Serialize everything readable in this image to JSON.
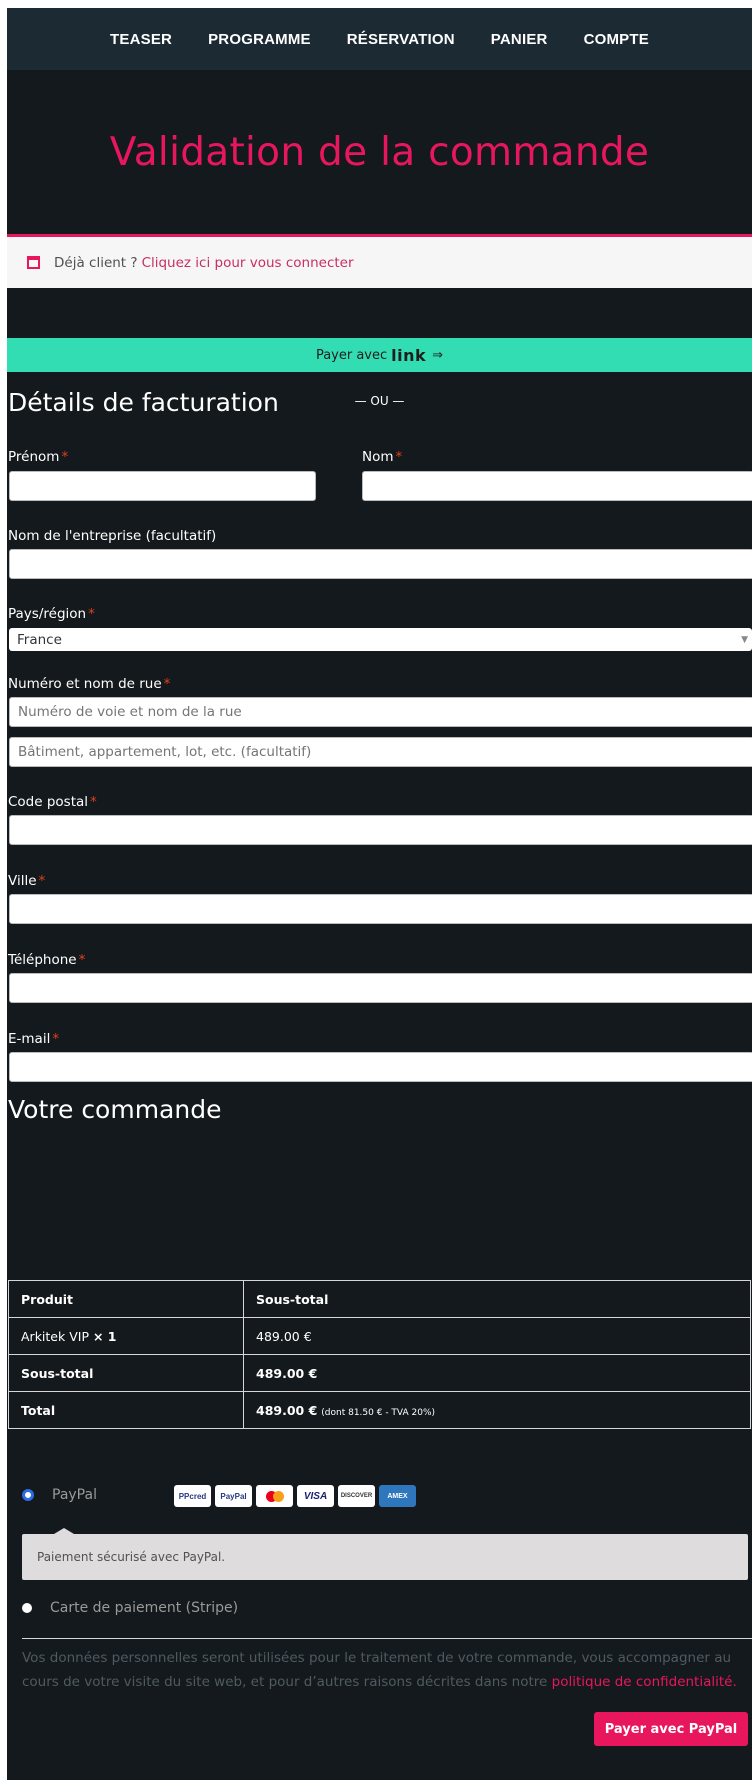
{
  "nav": {
    "items": [
      "TEASER",
      "PROGRAMME",
      "RÉSERVATION",
      "PANIER",
      "COMPTE"
    ]
  },
  "page_title": "Validation de la commande",
  "login_notice": {
    "text": "Déjà client ?",
    "link": "Cliquez ici pour vous connecter"
  },
  "link_button": {
    "prefix": "Payer avec",
    "brand": "link",
    "arrow": "⇒"
  },
  "or_separator": "— OU —",
  "billing": {
    "title": "Détails de facturation",
    "required_mark": "*",
    "first_name_label": "Prénom",
    "last_name_label": "Nom",
    "company_label": "Nom de l'entreprise (facultatif)",
    "country_label": "Pays/région",
    "country_value": "France",
    "street_label": "Numéro et nom de rue",
    "street_placeholder": "Numéro de voie et nom de la rue",
    "street2_placeholder": "Bâtiment, appartement, lot, etc. (facultatif)",
    "postcode_label": "Code postal",
    "city_label": "Ville",
    "phone_label": "Téléphone",
    "email_label": "E-mail"
  },
  "order": {
    "title": "Votre commande",
    "col_product": "Produit",
    "col_subtotal": "Sous-total",
    "item_name": "Arkitek VIP",
    "item_qty": "× 1",
    "item_price": "489.00 €",
    "subtotal_label": "Sous-total",
    "subtotal_value": "489.00 €",
    "total_label": "Total",
    "total_value": "489.00 €",
    "total_tax_note": "(dont 81.50 € - TVA 20%)"
  },
  "payment": {
    "paypal_label": "PayPal",
    "paypal_selected": true,
    "cards": [
      "PayPal CREDIT",
      "PayPal",
      "Mastercard",
      "VISA",
      "DISCOVER",
      "AMEX"
    ],
    "paypal_description": "Paiement sécurisé avec PayPal.",
    "stripe_label": "Carte de paiement (Stripe)",
    "stripe_selected": false
  },
  "privacy": {
    "text": "Vos données personnelles seront utilisées pour le traitement de votre commande, vous accompagner au cours de votre visite du site web, et pour d’autres raisons décrites dans notre",
    "link": "politique de confidentialité",
    "end": "."
  },
  "submit_button": "Payer avec PayPal",
  "colors": {
    "accent": "#e8175d",
    "background": "#14191d",
    "nav_background": "#1c2a33",
    "link_button": "#33ddb3"
  }
}
